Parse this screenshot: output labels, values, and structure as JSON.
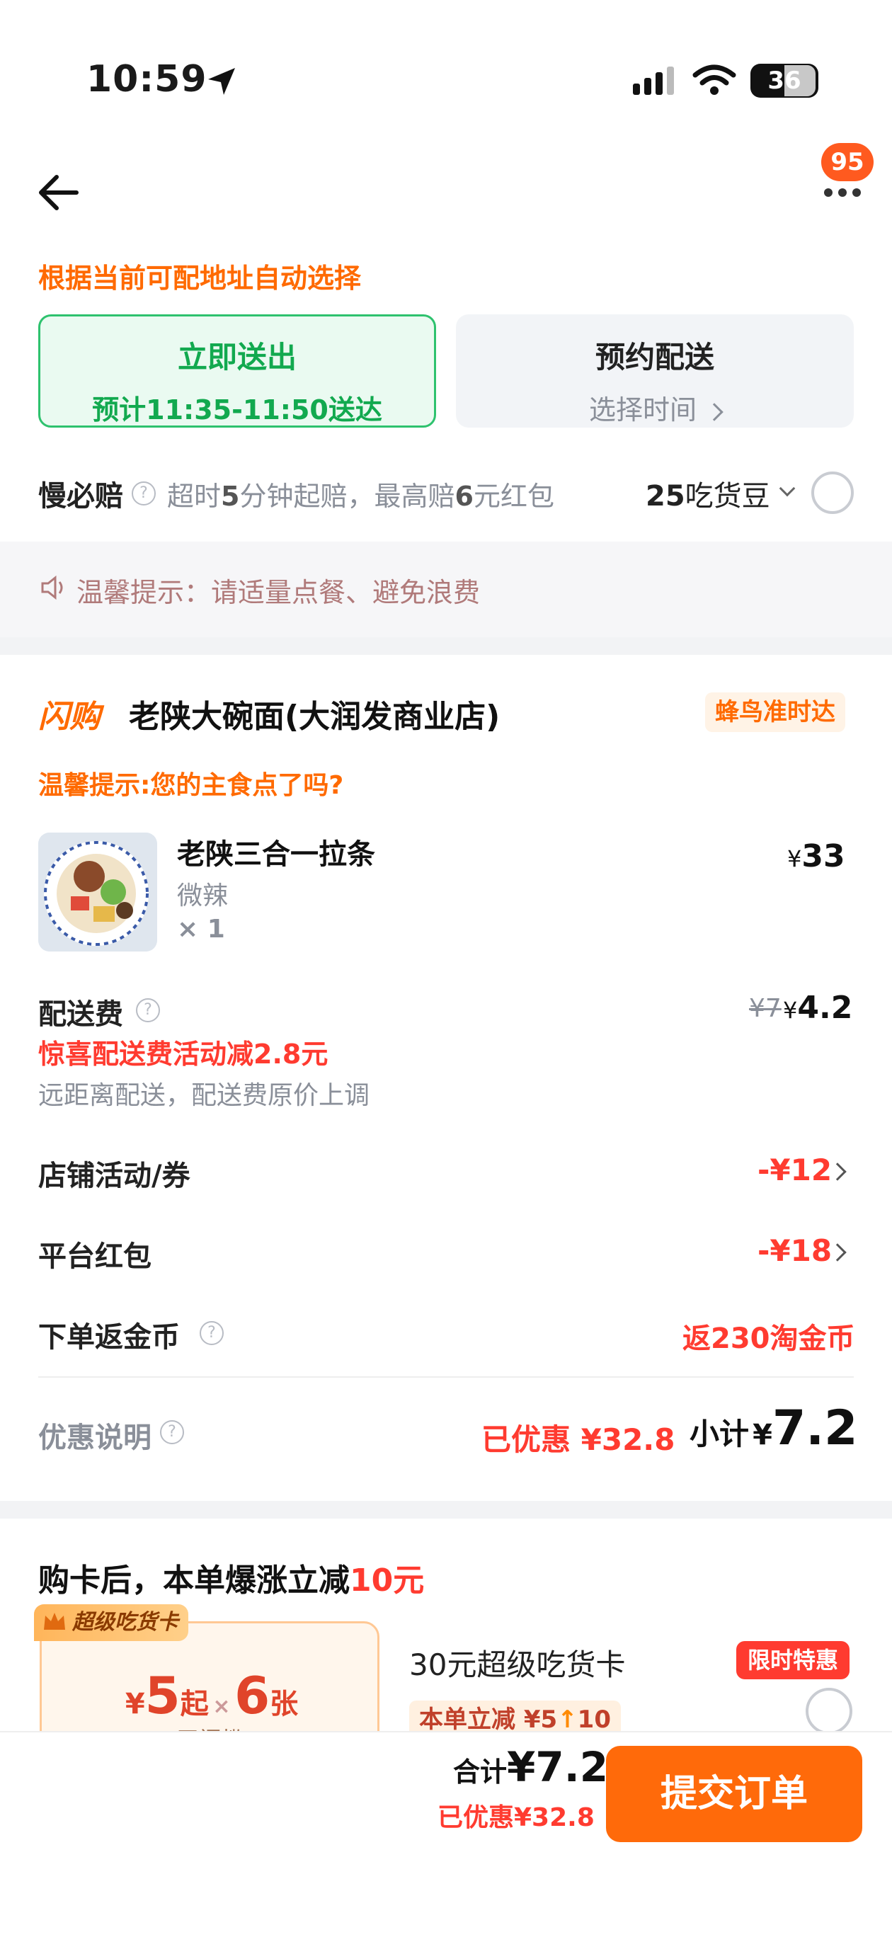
{
  "status_bar": {
    "time": "10:59",
    "battery": "36"
  },
  "header": {
    "more_badge": "95"
  },
  "auto_select_note": "根据当前可配地址自动选择",
  "delivery": {
    "immediate_title": "立即送出",
    "immediate_prefix": "预计",
    "immediate_time": "11:35-11:50",
    "immediate_suffix": "送达",
    "scheduled_title": "预约配送",
    "scheduled_sub": "选择时间"
  },
  "slow_guarantee": {
    "label": "慢必赔",
    "desc_1": "超时",
    "desc_min": "5",
    "desc_2": "分钟起赔，最高赔",
    "desc_amt": "6",
    "desc_3": "元红包",
    "beans_num": "25",
    "beans_label": "吃货豆"
  },
  "warm_tip": "温馨提示：请适量点餐、避免浪费",
  "store": {
    "flash_label": "闪购",
    "name": "老陕大碗面(大润发商业店)",
    "badge": "蜂鸟准时达",
    "staple_tip": "温馨提示:您的主食点了吗?"
  },
  "item": {
    "name": "老陕三合一拉条",
    "spec": "微辣",
    "qty": "× 1",
    "currency": "¥",
    "price": "33"
  },
  "fees": {
    "delivery_label": "配送费",
    "delivery_orig": "¥7",
    "delivery_currency": "¥",
    "delivery_price": "4.2",
    "delivery_promo_prefix": "惊喜配送费活动减",
    "delivery_promo_amt": "2.8",
    "delivery_promo_suffix": "元",
    "delivery_note": "远距离配送，配送费原价上调",
    "store_promo_label": "店铺活动/券",
    "store_promo_value": "-¥12",
    "platform_label": "平台红包",
    "platform_value": "-¥18",
    "coin_label": "下单返金币",
    "coin_value": "返230淘金币",
    "discount_label": "优惠说明",
    "discount_prefix": "已优惠",
    "discount_value": "¥32.8",
    "subtotal_label": "小计",
    "subtotal_currency": "¥",
    "subtotal_value": "7.2"
  },
  "card_promo": {
    "headline": "购卡后，本单爆涨立减",
    "headline_amt": "10元",
    "tag": "超级吃货卡",
    "price_currency": "¥",
    "price_num": "5",
    "price_unit": "起",
    "times": "×",
    "count_num": "6",
    "count_unit": "张",
    "threshold": "无门槛",
    "card_name": "30元超级吃货卡",
    "limited_badge": "限时特惠",
    "reduce_label": "本单立减 ¥5",
    "reduce_to": "10"
  },
  "footer": {
    "total_label": "合计",
    "total_value": "¥7.2",
    "saved_label": "已优惠¥32.8",
    "submit_label": "提交订单"
  },
  "colors": {
    "accent_orange": "#ff6a00",
    "price_red": "#ff3b30",
    "green": "#19b35a"
  }
}
